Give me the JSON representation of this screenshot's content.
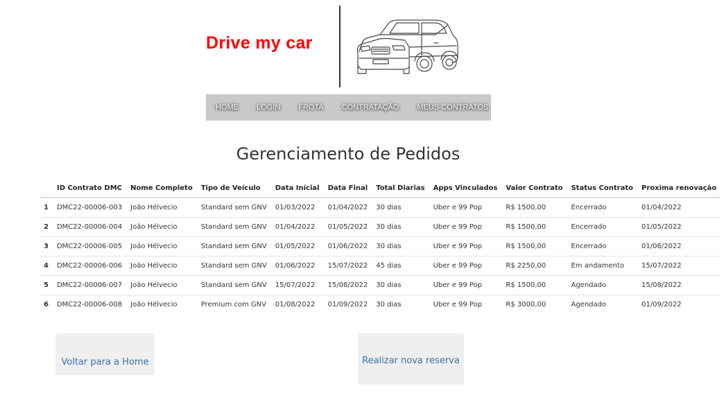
{
  "header": {
    "logo_text": "Drive my car",
    "logo_color": "#ff0000"
  },
  "nav": {
    "items": [
      "HOME",
      "LOGIN",
      "FROTA",
      "CONTRATAÇÃO",
      "MEUS CONTRATOS"
    ]
  },
  "page_title": "Gerenciamento de Pedidos",
  "table": {
    "headers": [
      "",
      "ID Contrato DMC",
      "Nome Completo",
      "Tipo de Veículo",
      "Data Inícial",
      "Data Final",
      "Total Diarias",
      "Apps Vinculados",
      "Valor Contrato",
      "Status Contrato",
      "Proxima renovação"
    ],
    "rows": [
      [
        "1",
        "DMC22-00006-003",
        "João Hélvecio",
        "Standard sem GNV",
        "01/03/2022",
        "01/04/2022",
        "30 dias",
        "Uber e 99 Pop",
        "R$ 1500,00",
        "Encerrado",
        "01/04/2022"
      ],
      [
        "2",
        "DMC22-00006-004",
        "João Hélvecio",
        "Standard sem GNV",
        "01/04/2022",
        "01/05/2022",
        "30 dias",
        "Uber e 99 Pop",
        "R$ 1500,00",
        "Encerrado",
        "01/05/2022"
      ],
      [
        "3",
        "DMC22-00006-005",
        "João Hélvecio",
        "Standard sem GNV",
        "01/05/2022",
        "01/06/2022",
        "30 dias",
        "Uber e 99 Pop",
        "R$ 1500,00",
        "Encerrado",
        "01/06/2022"
      ],
      [
        "4",
        "DMC22-00006-006",
        "João Hélvecio",
        "Standard sem GNV",
        "01/06/2022",
        "15/07/2022",
        "45 dias",
        "Uber e 99 Pop",
        "R$ 2250,00",
        "Em andamento",
        "15/07/2022"
      ],
      [
        "5",
        "DMC22-00006-007",
        "João Hélvecio",
        "Standard sem GNV",
        "15/07/2022",
        "15/08/2022",
        "30 dias",
        "Uber e 99 Pop",
        "R$ 1500,00",
        "Agendado",
        "15/08/2022"
      ],
      [
        "6",
        "DMC22-00006-008",
        "João Hélvecio",
        "Premium com GNV",
        "01/08/2022",
        "01/09/2022",
        "30 dias",
        "Uber e 99 Pop",
        "R$ 3000,00",
        "Agendado",
        "01/09/2022"
      ]
    ]
  },
  "buttons": {
    "home_label": "Voltar para a Home",
    "new_label": "Realizar nova reserva"
  },
  "icons": {
    "logo_image": "car-icon"
  }
}
